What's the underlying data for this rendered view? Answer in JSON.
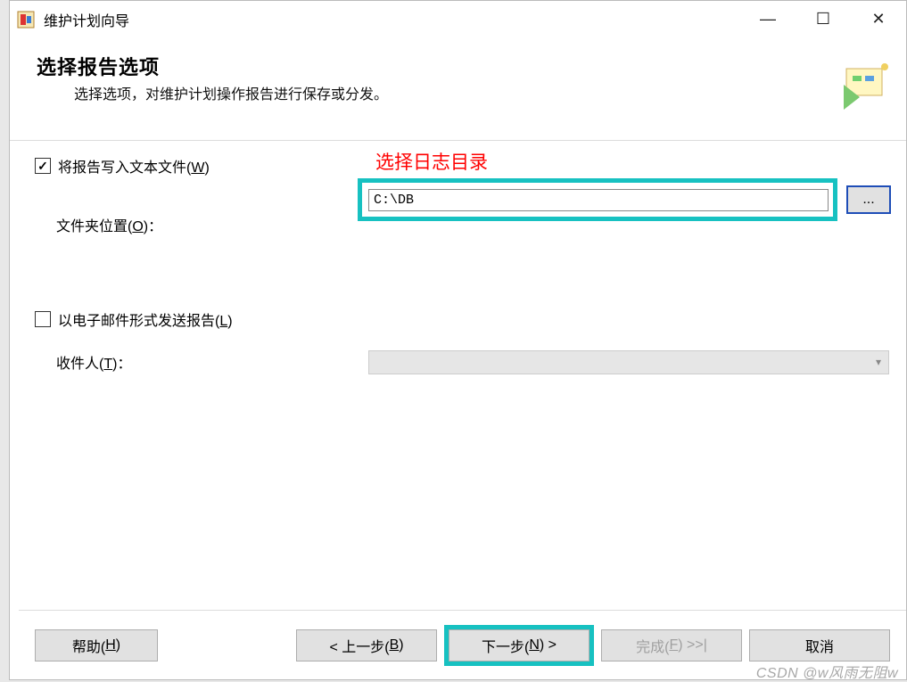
{
  "titlebar": {
    "title": "维护计划向导"
  },
  "header": {
    "main": "选择报告选项",
    "sub": "选择选项，对维护计划操作报告进行保存或分发。"
  },
  "annotation": "选择日志目录",
  "write_report": {
    "label_prefix": "将报告写入文本文件(",
    "mnemonic": "W",
    "label_suffix": ")",
    "checked": true
  },
  "folder": {
    "label_prefix": "文件夹位置(",
    "mnemonic": "O",
    "label_suffix": ")：",
    "value": "C:\\DB",
    "browse": "..."
  },
  "email": {
    "label_prefix": "以电子邮件形式发送报告(",
    "mnemonic": "L",
    "label_suffix": ")",
    "checked": false
  },
  "recipient": {
    "label_prefix": "收件人(",
    "mnemonic": "T",
    "label_suffix": ")："
  },
  "buttons": {
    "help_prefix": "帮助(",
    "help_mnemonic": "H",
    "help_suffix": ")",
    "back_prefix": "< 上一步(",
    "back_mnemonic": "B",
    "back_suffix": ")",
    "next_prefix": "下一步(",
    "next_mnemonic": "N",
    "next_suffix": ") >",
    "finish_prefix": "完成(",
    "finish_mnemonic": "F",
    "finish_suffix": ") >>|",
    "cancel": "取消"
  },
  "watermark": "CSDN @w风雨无阻w"
}
